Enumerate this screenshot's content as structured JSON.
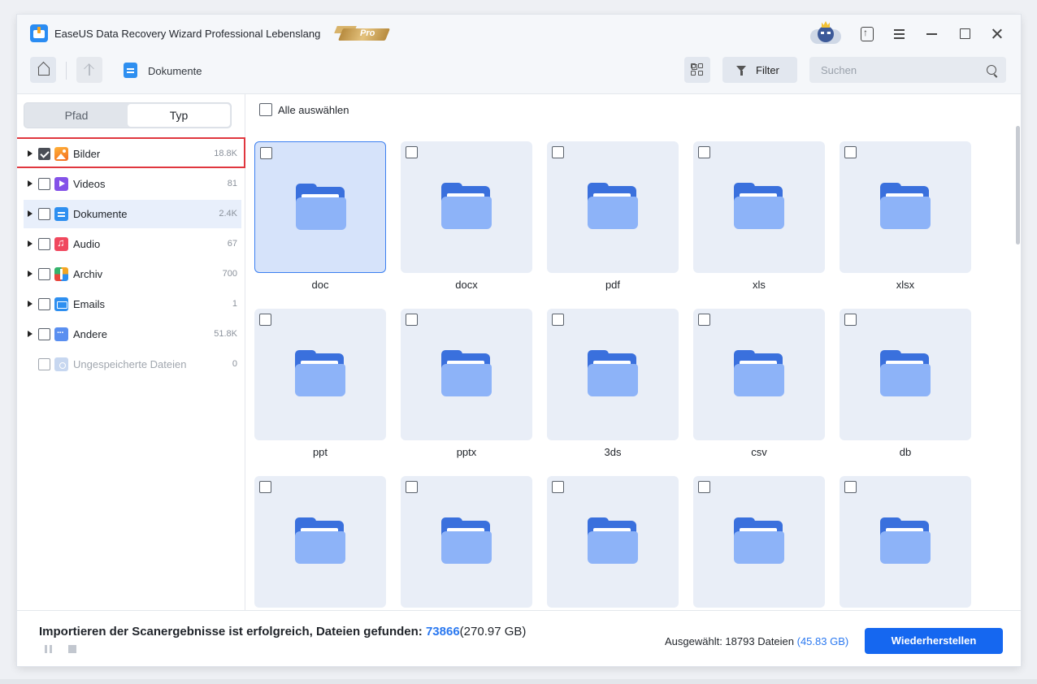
{
  "app": {
    "title": "EaseUS Data Recovery Wizard Professional Lebenslang",
    "badge": "Pro"
  },
  "toolbar": {
    "breadcrumb": "Dokumente",
    "filter_label": "Filter",
    "search_placeholder": "Suchen"
  },
  "sidebar": {
    "tabs": [
      "Pfad",
      "Typ"
    ],
    "active_tab": "Typ",
    "categories": [
      {
        "label": "Bilder",
        "count": "18.8K",
        "checked": true,
        "icon": "image-icon"
      },
      {
        "label": "Videos",
        "count": "81",
        "checked": false,
        "icon": "video-icon"
      },
      {
        "label": "Dokumente",
        "count": "2.4K",
        "checked": false,
        "icon": "document-icon",
        "active": true
      },
      {
        "label": "Audio",
        "count": "67",
        "checked": false,
        "icon": "audio-icon"
      },
      {
        "label": "Archiv",
        "count": "700",
        "checked": false,
        "icon": "archive-icon"
      },
      {
        "label": "Emails",
        "count": "1",
        "checked": false,
        "icon": "email-icon"
      },
      {
        "label": "Andere",
        "count": "51.8K",
        "checked": false,
        "icon": "other-icon"
      },
      {
        "label": "Ungespeicherte Dateien",
        "count": "0",
        "checked": false,
        "icon": "unsaved-file-icon",
        "disabled": true
      }
    ]
  },
  "content": {
    "select_all_label": "Alle auswählen",
    "folders": [
      {
        "name": "doc",
        "selected": true
      },
      {
        "name": "docx"
      },
      {
        "name": "pdf"
      },
      {
        "name": "xls"
      },
      {
        "name": "xlsx"
      },
      {
        "name": "ppt"
      },
      {
        "name": "pptx"
      },
      {
        "name": "3ds"
      },
      {
        "name": "csv"
      },
      {
        "name": "db"
      },
      {
        "name": ""
      },
      {
        "name": ""
      },
      {
        "name": ""
      },
      {
        "name": ""
      },
      {
        "name": ""
      }
    ]
  },
  "status": {
    "message": "Importieren der Scanergebnisse ist erfolgreich, Dateien gefunden: ",
    "found_count": "73866",
    "found_size": "(270.97 GB)",
    "selected_prefix": "Ausgewählt: 18793 Dateien ",
    "selected_size": "(45.83 GB)",
    "restore_label": "Wiederherstellen"
  },
  "colors": {
    "accent": "#1567f0",
    "highlight_box": "#e0373f",
    "folder_front": "#8db3f8",
    "folder_back": "#3a70dd"
  }
}
